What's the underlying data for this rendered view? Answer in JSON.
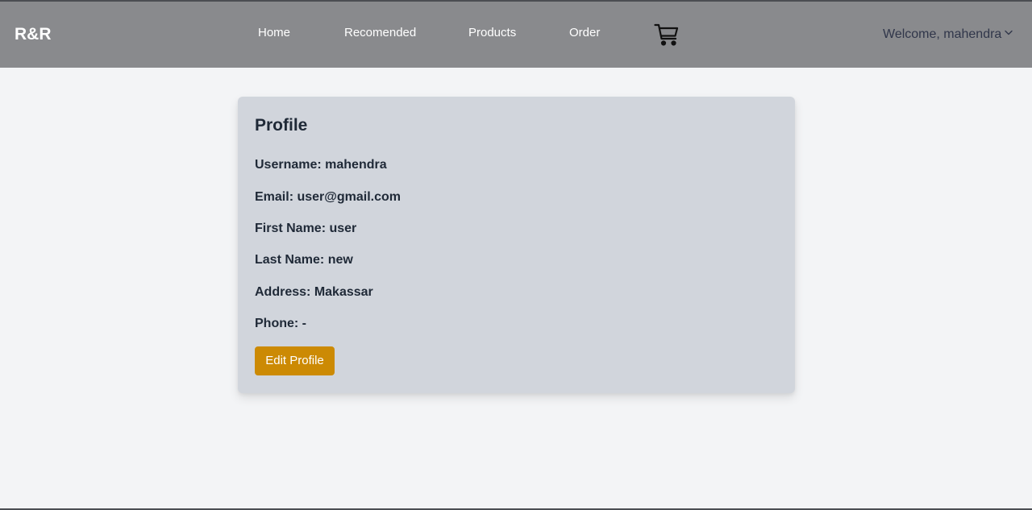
{
  "navbar": {
    "logo": "R&R",
    "links": [
      "Home",
      "Recomended",
      "Products",
      "Order"
    ],
    "cart_icon": "shopping-cart-icon",
    "welcome": "Welcome, mahendra",
    "welcome_icon": "chevron-down-icon"
  },
  "profile": {
    "title": "Profile",
    "fields": [
      {
        "label": "Username:",
        "value": "mahendra"
      },
      {
        "label": "Email:",
        "value": "user@gmail.com"
      },
      {
        "label": "First Name:",
        "value": "user"
      },
      {
        "label": "Last Name:",
        "value": "new"
      },
      {
        "label": "Address:",
        "value": "Makassar"
      },
      {
        "label": "Phone:",
        "value": "-"
      }
    ],
    "edit_button": "Edit Profile"
  },
  "colors": {
    "navbar": "#898a8d",
    "page_background": "#f3f4f6",
    "card_background": "#d1d5dc",
    "accent_button": "#cc8a04",
    "text_dark": "#1f2937"
  }
}
